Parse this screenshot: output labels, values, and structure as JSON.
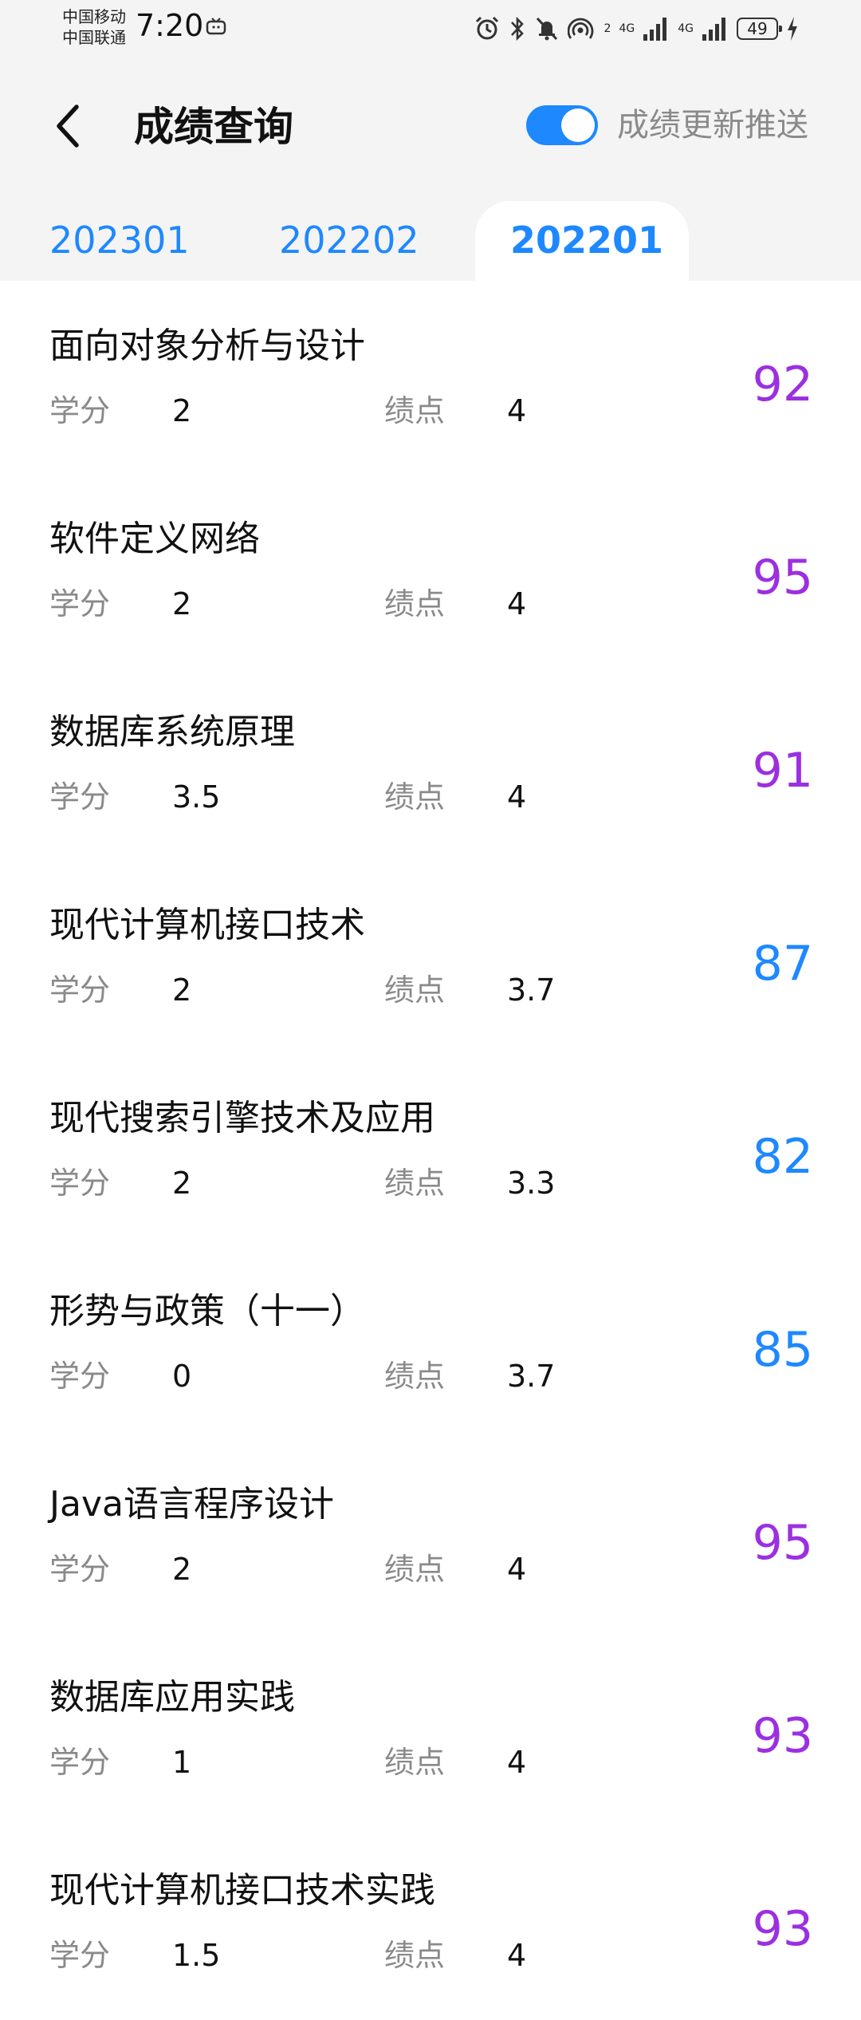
{
  "status_bar": {
    "carrier_1": "中国移动",
    "carrier_2": "中国联通",
    "time": "7:20",
    "battery": "49",
    "net_1": "4G",
    "net_2": "4G",
    "hotspot_sub": "2",
    "icons": [
      "tv-icon",
      "alarm-icon",
      "bluetooth-icon",
      "mute-icon",
      "hotspot-icon",
      "signal-icon",
      "signal-icon",
      "battery-icon",
      "charging-icon"
    ]
  },
  "header": {
    "title": "成绩查询",
    "push_label": "成绩更新推送",
    "push_enabled": true
  },
  "tabs": [
    {
      "label": "202301",
      "active": false
    },
    {
      "label": "202202",
      "active": false
    },
    {
      "label": "202201",
      "active": true
    }
  ],
  "labels": {
    "credit": "学分",
    "gpa": "绩点"
  },
  "colors": {
    "accent": "#1e88ff",
    "score_high": "#9b30e0",
    "score_mid": "#1e88ff",
    "label_gray": "#8a8a8a"
  },
  "courses": [
    {
      "name": "面向对象分析与设计",
      "credit": "2",
      "gpa": "4",
      "score": "92",
      "level": "high"
    },
    {
      "name": "软件定义网络",
      "credit": "2",
      "gpa": "4",
      "score": "95",
      "level": "high"
    },
    {
      "name": "数据库系统原理",
      "credit": "3.5",
      "gpa": "4",
      "score": "91",
      "level": "high"
    },
    {
      "name": "现代计算机接口技术",
      "credit": "2",
      "gpa": "3.7",
      "score": "87",
      "level": "mid"
    },
    {
      "name": "现代搜索引擎技术及应用",
      "credit": "2",
      "gpa": "3.3",
      "score": "82",
      "level": "mid"
    },
    {
      "name": "形势与政策（十一）",
      "credit": "0",
      "gpa": "3.7",
      "score": "85",
      "level": "mid"
    },
    {
      "name": "Java语言程序设计",
      "credit": "2",
      "gpa": "4",
      "score": "95",
      "level": "high"
    },
    {
      "name": "数据库应用实践",
      "credit": "1",
      "gpa": "4",
      "score": "93",
      "level": "high"
    },
    {
      "name": "现代计算机接口技术实践",
      "credit": "1.5",
      "gpa": "4",
      "score": "93",
      "level": "high"
    }
  ]
}
